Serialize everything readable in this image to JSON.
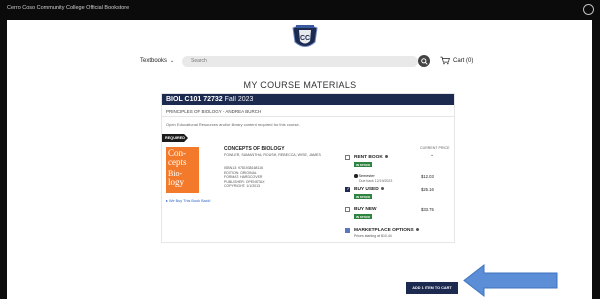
{
  "app": {
    "site_title": "Cerro Coso Community College Official Bookstore",
    "search_placeholder": "Search",
    "nav_textbooks": "Textbooks",
    "cart_label": "Cart (0)",
    "page_title": "MY COURSE MATERIALS"
  },
  "course": {
    "code": "BIOL C101 72732",
    "term": "Fall 2023",
    "subtitle": "PRINCIPLES OF BIOLOGY - ANDREA BURCH",
    "oer_note": "Open Educational Resources and/or library content required for this course.",
    "required_tag": "REQUIRED"
  },
  "book": {
    "cover": [
      "Con-",
      "cepts",
      "Bio-",
      "logy"
    ],
    "title": "CONCEPTS OF BIOLOGY",
    "authors": "FOWLER, SAMANTHA; ROUSH, REBECCA; WISE, JAMES",
    "meta": [
      "ISBN13: 9781938168116",
      "EDITION: ORIGINAL",
      "FORMAT: HARDCOVER",
      "PUBLISHER: OPENSTAX",
      "COPYRIGHT: 1/1/2013"
    ],
    "bought_link": "We Buy This Book Back!"
  },
  "pricing": {
    "current_price_label": "CURRENT PRICE",
    "options": [
      {
        "label": "RENT BOOK",
        "stock": "IN STOCK",
        "price": "$12.03",
        "checked": false
      },
      {
        "label": "BUY USED",
        "stock": "IN STOCK",
        "price": "$25.16",
        "checked": true
      },
      {
        "label": "BUY NEW",
        "stock": "IN STOCK",
        "price": "$33.75",
        "checked": false
      },
      {
        "label": "MARKETPLACE OPTIONS",
        "stock": "",
        "price": "",
        "checked": false
      }
    ],
    "rent_term": "Semester",
    "rent_due": "Due back 12/19/2023",
    "marketplace_sub": "Prices starting at $10.44"
  },
  "actions": {
    "add_to_cart": "ADD 1 ITEM TO CART"
  },
  "colors": {
    "navy": "#1c2a4f",
    "stock_green": "#2e8540",
    "cover_orange": "#f37a2b",
    "arrow_blue": "#5b8ed6"
  }
}
